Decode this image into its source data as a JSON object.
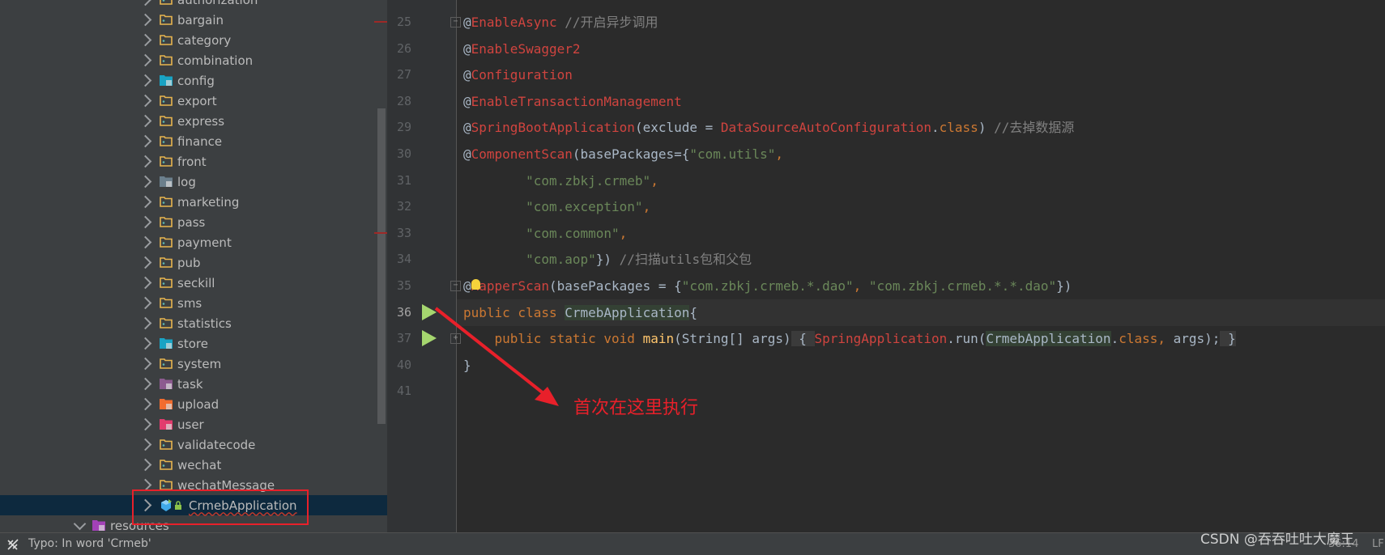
{
  "project_tree": {
    "items": [
      {
        "label": "authorization",
        "icon": "package-folder-icon"
      },
      {
        "label": "bargain",
        "icon": "package-folder-icon"
      },
      {
        "label": "category",
        "icon": "package-folder-icon"
      },
      {
        "label": "combination",
        "icon": "package-folder-icon"
      },
      {
        "label": "config",
        "icon": "config-folder-icon"
      },
      {
        "label": "export",
        "icon": "package-folder-icon"
      },
      {
        "label": "express",
        "icon": "package-folder-icon"
      },
      {
        "label": "finance",
        "icon": "package-folder-icon"
      },
      {
        "label": "front",
        "icon": "package-folder-icon"
      },
      {
        "label": "log",
        "icon": "log-folder-icon"
      },
      {
        "label": "marketing",
        "icon": "package-folder-icon"
      },
      {
        "label": "pass",
        "icon": "package-folder-icon"
      },
      {
        "label": "payment",
        "icon": "package-folder-icon"
      },
      {
        "label": "pub",
        "icon": "package-folder-icon"
      },
      {
        "label": "seckill",
        "icon": "package-folder-icon"
      },
      {
        "label": "sms",
        "icon": "package-folder-icon"
      },
      {
        "label": "statistics",
        "icon": "package-folder-icon"
      },
      {
        "label": "store",
        "icon": "store-folder-icon"
      },
      {
        "label": "system",
        "icon": "package-folder-icon"
      },
      {
        "label": "task",
        "icon": "task-folder-icon"
      },
      {
        "label": "upload",
        "icon": "upload-folder-icon"
      },
      {
        "label": "user",
        "icon": "user-folder-icon"
      },
      {
        "label": "validatecode",
        "icon": "package-folder-icon"
      },
      {
        "label": "wechat",
        "icon": "package-folder-icon"
      },
      {
        "label": "wechatMessage",
        "icon": "package-folder-icon"
      },
      {
        "label": "CrmebApplication",
        "icon": "spring-boot-class-icon",
        "selected": true,
        "locked": true
      }
    ],
    "resources": {
      "label": "resources",
      "icon": "resources-folder-icon",
      "expanded": true
    }
  },
  "editor": {
    "current_line": 36,
    "lines": [
      {
        "n": 25,
        "tokens": [
          [
            "@",
            "at"
          ],
          [
            "EnableAsync",
            "ann"
          ],
          [
            " //开启异步调用",
            "cmt"
          ]
        ]
      },
      {
        "n": 26,
        "tokens": [
          [
            "@",
            "at"
          ],
          [
            "EnableSwagger2",
            "ann"
          ]
        ]
      },
      {
        "n": 27,
        "tokens": [
          [
            "@",
            "at"
          ],
          [
            "Configuration",
            "ann"
          ]
        ]
      },
      {
        "n": 28,
        "tokens": [
          [
            "@",
            "at"
          ],
          [
            "EnableTransactionManagement",
            "ann"
          ]
        ]
      },
      {
        "n": 29,
        "tokens": [
          [
            "@",
            "at"
          ],
          [
            "SpringBootApplication",
            "ann"
          ],
          [
            "(exclude = ",
            "plain"
          ],
          [
            "DataSourceAutoConfiguration",
            "cls"
          ],
          [
            ".",
            "plain"
          ],
          [
            "class",
            "kw"
          ],
          [
            ") ",
            "plain"
          ],
          [
            "//去掉数据源",
            "cmt"
          ]
        ]
      },
      {
        "n": 30,
        "tokens": [
          [
            "@",
            "at"
          ],
          [
            "ComponentScan",
            "ann"
          ],
          [
            "(basePackages={",
            "plain"
          ],
          [
            "\"com.utils\"",
            "str"
          ],
          [
            ",",
            "kw"
          ]
        ]
      },
      {
        "n": 31,
        "tokens": [
          [
            "        ",
            "plain"
          ],
          [
            "\"com.zbkj.crmeb\"",
            "str"
          ],
          [
            ",",
            "kw"
          ]
        ]
      },
      {
        "n": 32,
        "tokens": [
          [
            "        ",
            "plain"
          ],
          [
            "\"com.exception\"",
            "str"
          ],
          [
            ",",
            "kw"
          ]
        ]
      },
      {
        "n": 33,
        "tokens": [
          [
            "        ",
            "plain"
          ],
          [
            "\"com.common\"",
            "str"
          ],
          [
            ",",
            "kw"
          ]
        ]
      },
      {
        "n": 34,
        "tokens": [
          [
            "        ",
            "plain"
          ],
          [
            "\"com.aop\"",
            "str"
          ],
          [
            "}) ",
            "plain"
          ],
          [
            "//扫描utils包和父包",
            "cmt"
          ]
        ]
      },
      {
        "n": 35,
        "tokens": [
          [
            "@",
            "at"
          ],
          [
            "MapperScan",
            "ann"
          ],
          [
            "(basePackages = {",
            "plain"
          ],
          [
            "\"com.zbkj.crmeb.*.dao\"",
            "str"
          ],
          [
            ", ",
            "kw"
          ],
          [
            "\"com.zbkj.crmeb.*.*.dao\"",
            "str"
          ],
          [
            "})",
            "plain"
          ]
        ]
      },
      {
        "n": 36,
        "tokens": [
          [
            "public class ",
            "kw"
          ],
          [
            "CrmebApplication",
            "hl"
          ],
          [
            "{",
            "plain"
          ]
        ]
      },
      {
        "n": 37,
        "tokens": [
          [
            "    public static void ",
            "kw"
          ],
          [
            "main",
            "fn"
          ],
          [
            "(String[] args)",
            "plain"
          ],
          [
            " { ",
            "fold"
          ],
          [
            "SpringApplication",
            "cls"
          ],
          [
            ".run(",
            "plain"
          ],
          [
            "CrmebApplication",
            "hl"
          ],
          [
            ".",
            "plain"
          ],
          [
            "class",
            "kw"
          ],
          [
            ", ",
            "kw"
          ],
          [
            "args);",
            "plain"
          ],
          [
            " }",
            "fold"
          ]
        ]
      },
      {
        "n": 40,
        "tokens": [
          [
            "}",
            "plain"
          ]
        ]
      },
      {
        "n": 41,
        "tokens": []
      }
    ]
  },
  "annotation": {
    "note": "首次在这里执行",
    "color": "#e8202a"
  },
  "status_bar": {
    "message": "Typo: In word 'Crmeb'",
    "caret_position": "36:14",
    "line_separator": "LF"
  },
  "watermark": "CSDN @吞吞吐吐大魔王"
}
